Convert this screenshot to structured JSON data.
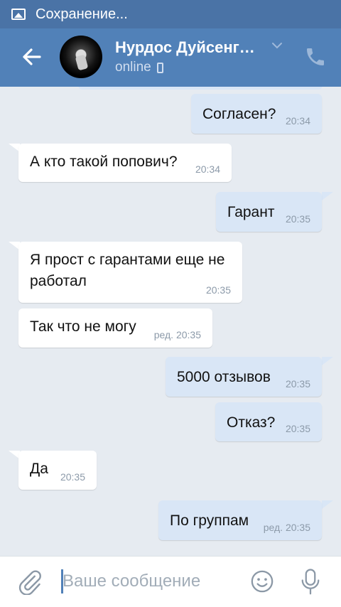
{
  "status_bar": {
    "text": "Сохранение..."
  },
  "header": {
    "name": "Нурдос Дуйсенг…",
    "status": "online"
  },
  "messages": [
    {
      "dir": "out",
      "text": "Согласен?",
      "time": "20:34"
    },
    {
      "dir": "in",
      "text": "А кто такой попович?",
      "time": "20:34"
    },
    {
      "dir": "out",
      "text": "Гарант",
      "time": "20:35"
    },
    {
      "dir": "in",
      "text": "Я прост с гарантами еще не работал",
      "time": "20:35"
    },
    {
      "dir": "in",
      "text": "Так что не могу",
      "time": "ред. 20:35"
    },
    {
      "dir": "out",
      "text": "5000 отзывов",
      "time": "20:35"
    },
    {
      "dir": "out",
      "text": "Отказ?",
      "time": "20:35"
    },
    {
      "dir": "in",
      "text": "Да",
      "time": "20:35"
    },
    {
      "dir": "out",
      "text": "По группам",
      "time": "ред. 20:35"
    }
  ],
  "composer": {
    "placeholder": "Ваше сообщение"
  },
  "colors": {
    "header": "#5181b8",
    "status_bar": "#4a73a6",
    "outgoing": "#d9e6f6",
    "incoming": "#ffffff",
    "background": "#e6ebf1"
  }
}
